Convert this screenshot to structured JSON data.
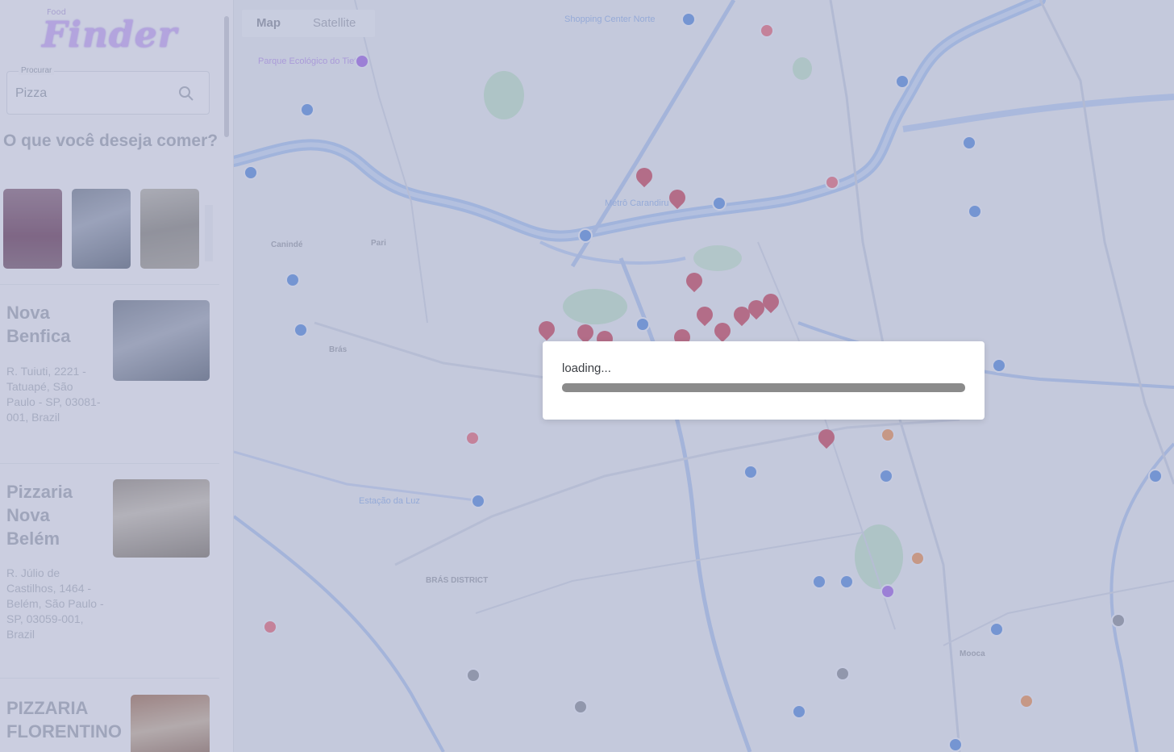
{
  "sidebar": {
    "logo_small": "Food",
    "logo": "Finder",
    "search": {
      "legend": "Procurar",
      "value": "Pizza"
    },
    "question": "O que você deseja comer?",
    "places": [
      {
        "name": "Nova Benfica",
        "address": "R. Tuiuti, 2221 - Tatuapé, São Paulo - SP, 03081-001, Brazil"
      },
      {
        "name": "Pizzaria Nova Belém",
        "address": "R. Júlio de Castilhos, 1464 - Belém, São Paulo - SP, 03059-001, Brazil"
      },
      {
        "name": "PIZZARIA FLORENTINO",
        "address": ""
      }
    ]
  },
  "map": {
    "tabs": [
      "Map",
      "Satellite"
    ],
    "labels": [
      "Parque Ecológico do Tietê",
      "Shopping Center Norte",
      "Metrô Carandiru",
      "BRÁS DISTRICT",
      "Mooca",
      "Brás",
      "Estação da Luz",
      "Pari",
      "Canindé"
    ]
  },
  "modal": {
    "text": "loading...",
    "progress": 1.0
  }
}
